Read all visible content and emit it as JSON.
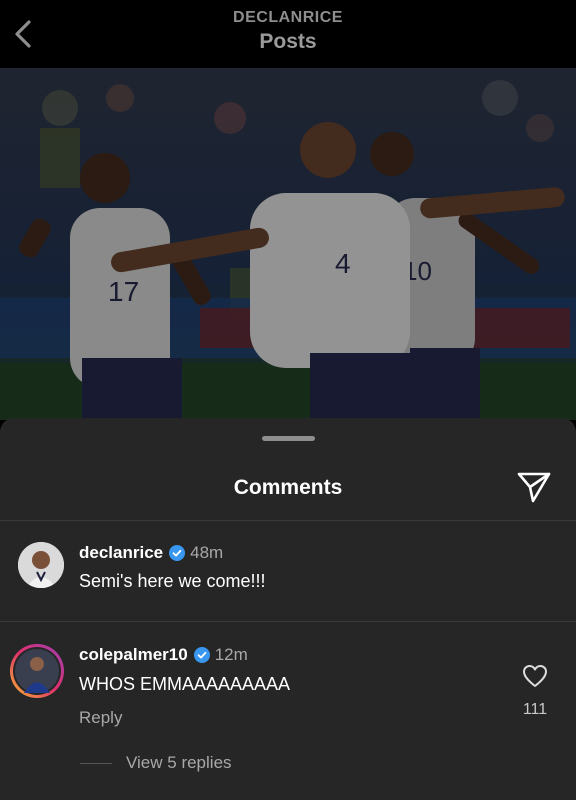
{
  "header": {
    "username": "DECLANRICE",
    "title": "Posts",
    "back_icon": "chevron-left-icon"
  },
  "post": {
    "image_alt": "England players celebrating",
    "jersey_numbers": [
      "17",
      "4",
      "10"
    ]
  },
  "comments_sheet": {
    "title": "Comments",
    "share_icon": "paper-plane-icon",
    "comments": [
      {
        "username": "declanrice",
        "verified": true,
        "time": "48m",
        "text": "Semi's here we come!!!"
      },
      {
        "username": "colepalmer10",
        "verified": true,
        "time": "12m",
        "text": "WHOS EMMAAAAAAAAA",
        "reply_label": "Reply",
        "likes": "111",
        "view_replies": "View 5 replies"
      }
    ]
  },
  "colors": {
    "sheet_bg": "#262626",
    "verified_blue": "#3897f0",
    "muted_text": "#a8a8a8"
  }
}
